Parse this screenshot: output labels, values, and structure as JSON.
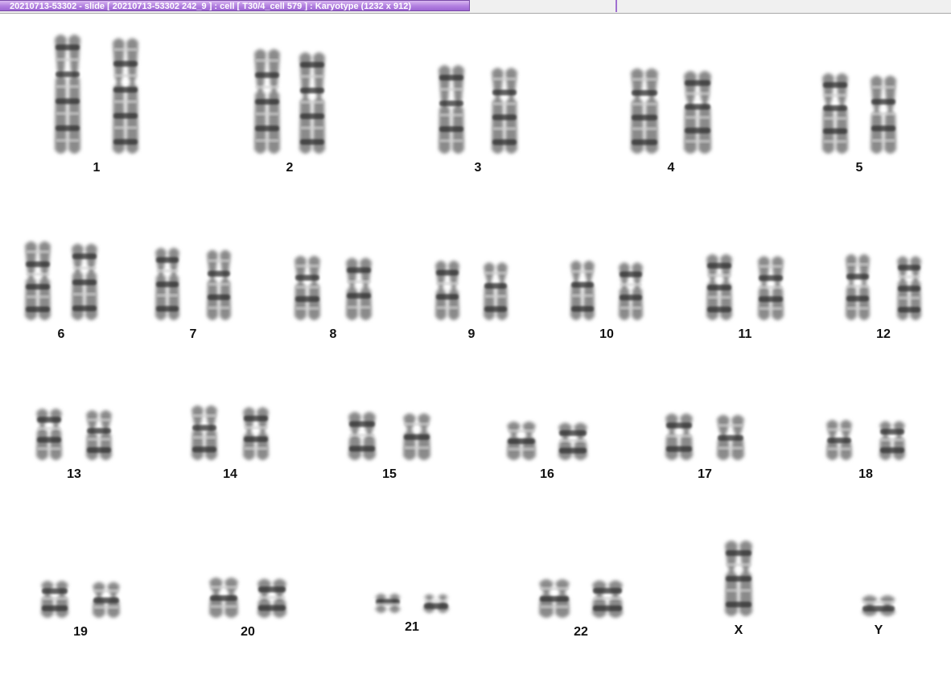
{
  "window": {
    "title": "20210713-53302 - slide [ 20210713-53302 242_9 ] : cell [ T30/4_cell 579 ] : Karyotype  (1232 x 912)"
  },
  "karyotype": {
    "chromosomes": [
      {
        "label": "1",
        "count": 2
      },
      {
        "label": "2",
        "count": 2
      },
      {
        "label": "3",
        "count": 2
      },
      {
        "label": "4",
        "count": 2
      },
      {
        "label": "5",
        "count": 2
      },
      {
        "label": "6",
        "count": 2
      },
      {
        "label": "7",
        "count": 2
      },
      {
        "label": "8",
        "count": 2
      },
      {
        "label": "9",
        "count": 2
      },
      {
        "label": "10",
        "count": 2
      },
      {
        "label": "11",
        "count": 2
      },
      {
        "label": "12",
        "count": 2
      },
      {
        "label": "13",
        "count": 2
      },
      {
        "label": "14",
        "count": 2
      },
      {
        "label": "15",
        "count": 2
      },
      {
        "label": "16",
        "count": 2
      },
      {
        "label": "17",
        "count": 2
      },
      {
        "label": "18",
        "count": 2
      },
      {
        "label": "19",
        "count": 2
      },
      {
        "label": "20",
        "count": 2
      },
      {
        "label": "21",
        "count": 2
      },
      {
        "label": "22",
        "count": 2
      },
      {
        "label": "X",
        "count": 1
      },
      {
        "label": "Y",
        "count": 1
      }
    ]
  }
}
